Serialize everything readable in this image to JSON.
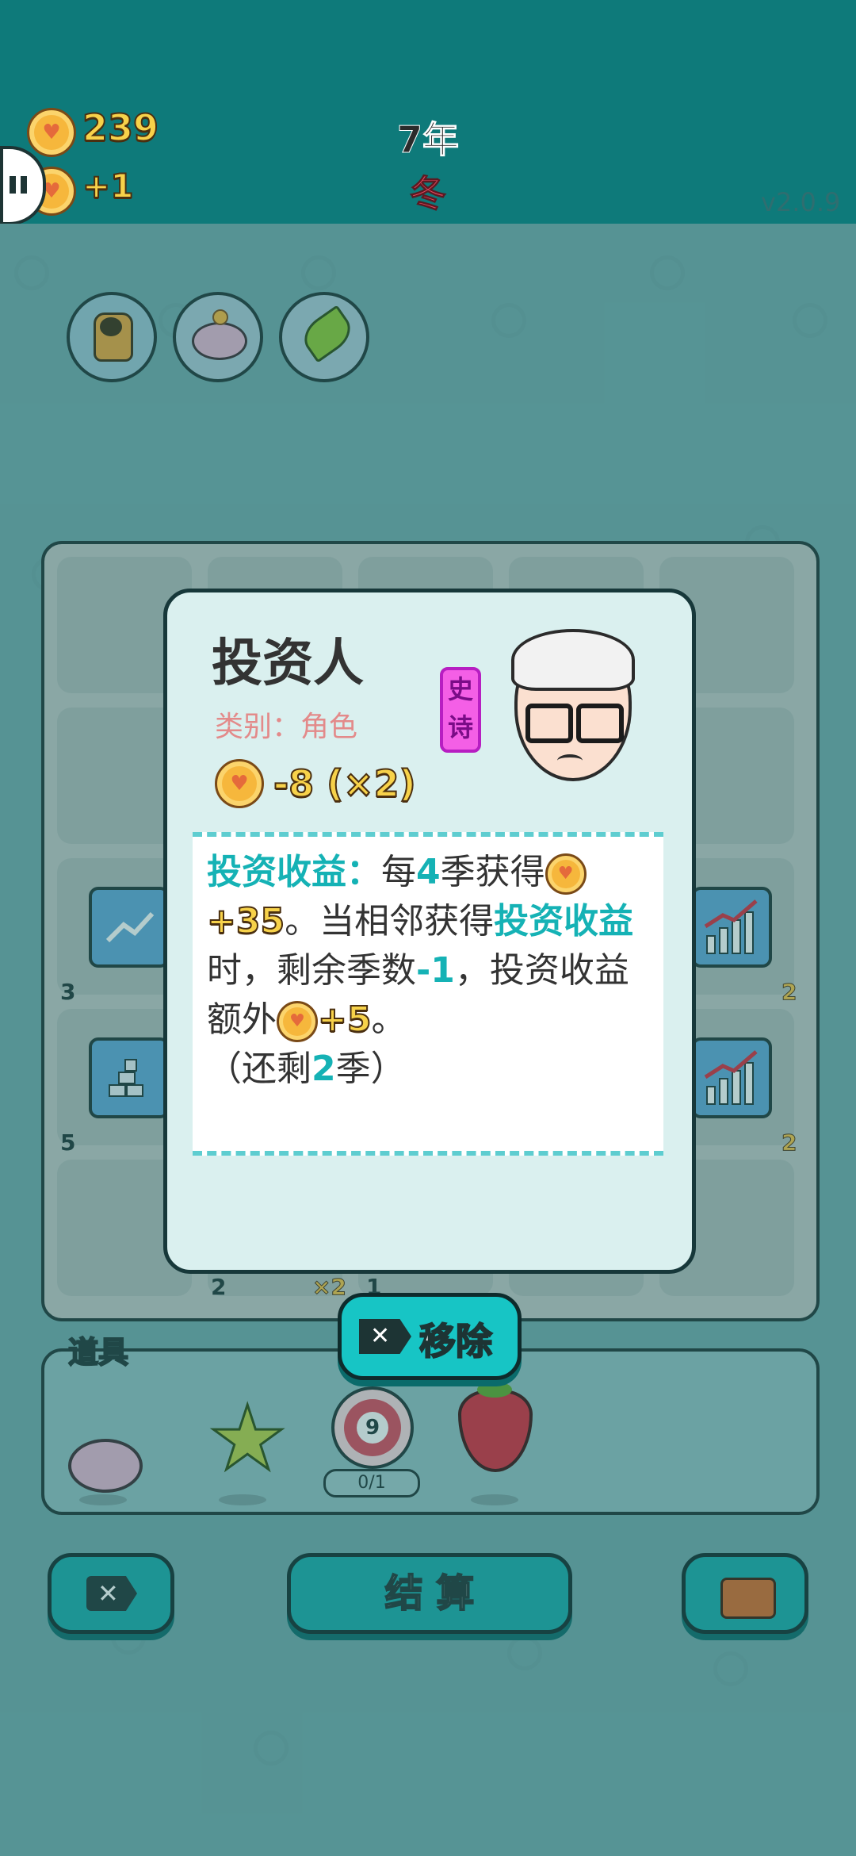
{
  "header": {
    "coins": "239",
    "coin_income": "+1",
    "year": "7年",
    "season": "冬",
    "version": "v2.0.9"
  },
  "top_icons": [
    "cat-icon",
    "piggy-bank-icon",
    "leaf-icon"
  ],
  "board": {
    "left_labels": [
      "3",
      "5"
    ],
    "right_labels": [
      "2",
      "2"
    ],
    "bottom_labels": [
      "2",
      "×2",
      "1"
    ]
  },
  "popup": {
    "title": "投资人",
    "category_label": "类别：角色",
    "rarity_tag": "史诗",
    "cost": "-8 (×2)",
    "desc": {
      "skill_name": "投资收益：",
      "t1": "每",
      "n1": "4",
      "t2": "季获得",
      "gain": "+35",
      "t3": "。当相邻获得",
      "skill_ref": "投资收益",
      "t4": "时，剩余季数",
      "n2": "-1",
      "t5": "，投资收益额外",
      "bonus": "+5",
      "t6": "。",
      "remain_a": "（还剩",
      "remain_n": "2",
      "remain_b": "季）"
    }
  },
  "remove_button": "移除",
  "items_panel": {
    "title": "道具",
    "target_number": "9",
    "target_count": "0/1"
  },
  "bottom_bar": {
    "settle_label": "结 算"
  },
  "colors": {
    "header": "#0e7a7a",
    "accent_teal": "#15b2b5",
    "coin": "#f6b73c",
    "tag_magenta": "#f45fe6"
  }
}
